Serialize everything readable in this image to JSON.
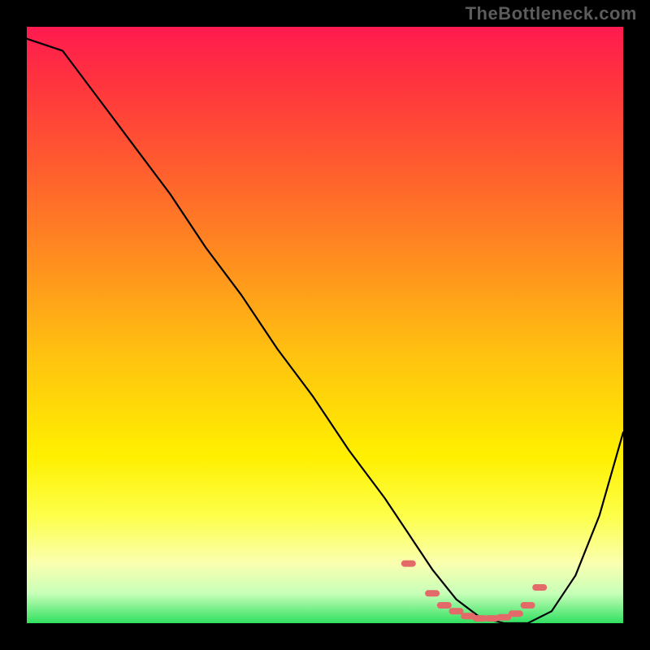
{
  "watermark": "TheBottleneck.com",
  "chart_data": {
    "type": "line",
    "title": "",
    "xlabel": "",
    "ylabel": "",
    "xlim": [
      0,
      100
    ],
    "ylim": [
      0,
      100
    ],
    "series": [
      {
        "name": "curve",
        "x": [
          0,
          6,
          12,
          18,
          24,
          30,
          36,
          42,
          48,
          54,
          60,
          64,
          68,
          72,
          76,
          80,
          84,
          88,
          92,
          96,
          100
        ],
        "y": [
          98,
          96,
          88,
          80,
          72,
          63,
          55,
          46,
          38,
          29,
          21,
          15,
          9,
          4,
          1,
          0,
          0,
          2,
          8,
          18,
          32
        ]
      }
    ],
    "markers": {
      "x": [
        64,
        68,
        70,
        72,
        74,
        76,
        78,
        80,
        82,
        84,
        86
      ],
      "y": [
        10,
        5,
        3,
        2,
        1.2,
        0.8,
        0.8,
        1.0,
        1.6,
        3,
        6
      ]
    },
    "gradient_stops": [
      {
        "pos": 0.0,
        "color": "#ff1a50"
      },
      {
        "pos": 0.22,
        "color": "#ff5830"
      },
      {
        "pos": 0.55,
        "color": "#ffc210"
      },
      {
        "pos": 0.82,
        "color": "#fdff4a"
      },
      {
        "pos": 1.0,
        "color": "#30e060"
      }
    ]
  }
}
